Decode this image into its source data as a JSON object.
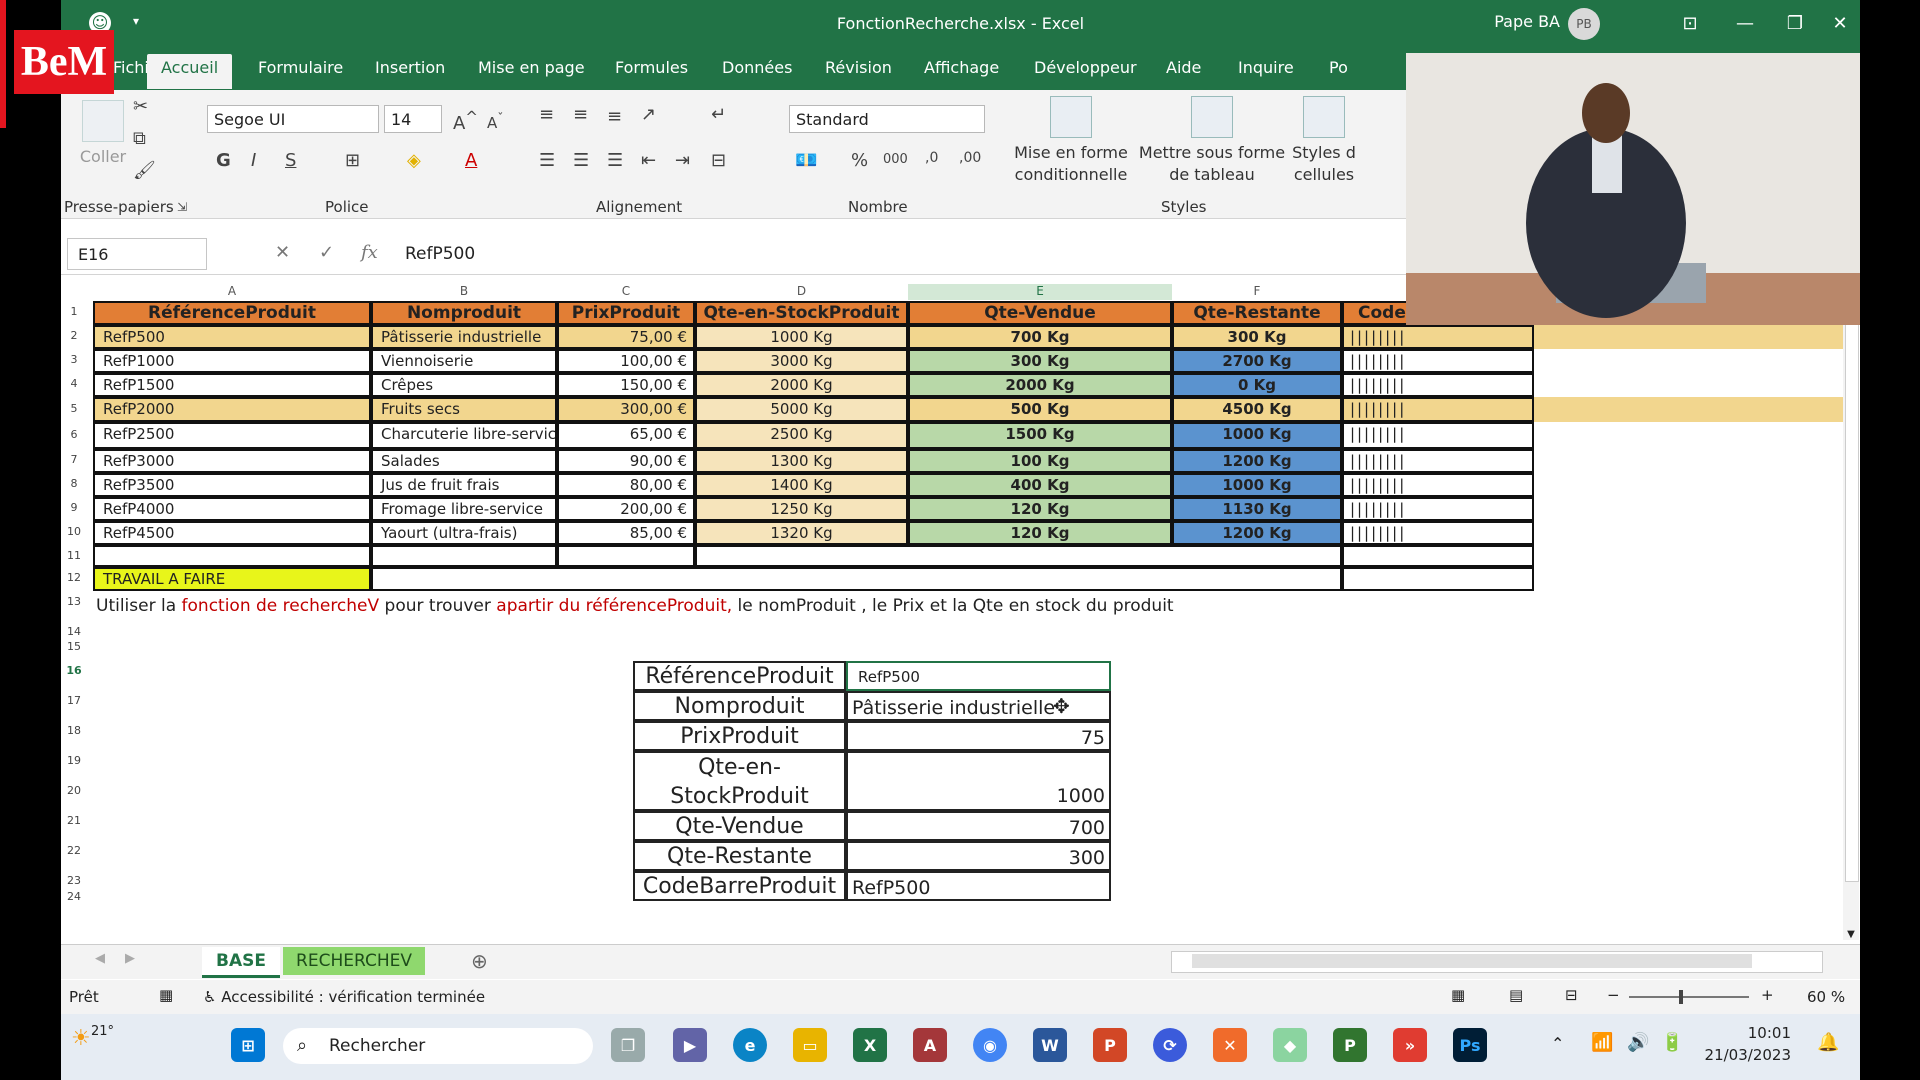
{
  "window": {
    "title": "FonctionRecherche.xlsx  -  Excel",
    "user": "Pape BA",
    "avatar": "PB"
  },
  "logo": {
    "text": "BeM"
  },
  "tabs": [
    "Fichier",
    "Accueil",
    "Formulaire",
    "Insertion",
    "Mise en page",
    "Formules",
    "Données",
    "Révision",
    "Affichage",
    "Développeur",
    "Aide",
    "Inquire",
    "Po"
  ],
  "active_tab": "Accueil",
  "ribbon": {
    "paste_label": "Coller",
    "group_clipboard": "Presse-papiers",
    "font_name": "Segoe UI",
    "font_size": "14",
    "group_font": "Police",
    "group_alignment": "Alignement",
    "number_format": "Standard",
    "group_number": "Nombre",
    "cond_format_1": "Mise en forme",
    "cond_format_2": "conditionnelle",
    "table_format_1": "Mettre sous forme",
    "table_format_2": "de tableau",
    "cell_styles_1": "Styles d",
    "cell_styles_2": "cellules",
    "group_styles": "Styles",
    "bold": "G",
    "italic": "I",
    "underline": "S",
    "percent": "%",
    "thousands": "000"
  },
  "formula_bar": {
    "name_box": "E16",
    "fx": "fx",
    "value": "RefP500"
  },
  "columns": [
    "A",
    "B",
    "C",
    "D",
    "E",
    "F"
  ],
  "table_headers": [
    "RéférenceProduit",
    "Nomproduit",
    "PrixProduit",
    "Qte-en-StockProduit",
    "Qte-Vendue",
    "Qte-Restante",
    "Code"
  ],
  "rows": [
    {
      "ref": "RefP500",
      "nom": "Pâtisserie industrielle",
      "prix": "75,00 €",
      "stock": "1000  Kg",
      "vendue": "700  Kg",
      "restante": "300  Kg",
      "code": "||||||||"
    },
    {
      "ref": "RefP1000",
      "nom": "Viennoiserie",
      "prix": "100,00 €",
      "stock": "3000  Kg",
      "vendue": "300  Kg",
      "restante": "2700  Kg",
      "code": "||||||||"
    },
    {
      "ref": "RefP1500",
      "nom": "Crêpes",
      "prix": "150,00 €",
      "stock": "2000  Kg",
      "vendue": "2000  Kg",
      "restante": "0  Kg",
      "code": "||||||||"
    },
    {
      "ref": "RefP2000",
      "nom": "Fruits secs",
      "prix": "300,00 €",
      "stock": "5000  Kg",
      "vendue": "500  Kg",
      "restante": "4500  Kg",
      "code": "||||||||"
    },
    {
      "ref": "RefP2500",
      "nom": "Charcuterie libre-service",
      "prix": "65,00 €",
      "stock": "2500  Kg",
      "vendue": "1500  Kg",
      "restante": "1000  Kg",
      "code": "||||||||"
    },
    {
      "ref": "RefP3000",
      "nom": "Salades",
      "prix": "90,00 €",
      "stock": "1300  Kg",
      "vendue": "100  Kg",
      "restante": "1200  Kg",
      "code": "||||||||"
    },
    {
      "ref": "RefP3500",
      "nom": "Jus de fruit frais",
      "prix": "80,00 €",
      "stock": "1400  Kg",
      "vendue": "400  Kg",
      "restante": "1000  Kg",
      "code": "||||||||"
    },
    {
      "ref": "RefP4000",
      "nom": "Fromage libre-service",
      "prix": "200,00 €",
      "stock": "1250  Kg",
      "vendue": "120  Kg",
      "restante": "1130  Kg",
      "code": "||||||||"
    },
    {
      "ref": "RefP4500",
      "nom": "Yaourt (ultra-frais)",
      "prix": "85,00 €",
      "stock": "1320  Kg",
      "vendue": "120  Kg",
      "restante": "1200  Kg",
      "code": "||||||||"
    }
  ],
  "row_numbers": [
    "1",
    "2",
    "3",
    "4",
    "5",
    "6",
    "7",
    "8",
    "9",
    "10",
    "11",
    "12",
    "13",
    "14",
    "15",
    "16",
    "17",
    "18",
    "19",
    "20",
    "21",
    "22",
    "23",
    "24"
  ],
  "travail": "TRAVAIL A FAIRE",
  "instruction": {
    "p1": "Utiliser la ",
    "p2": "fonction de rechercheV",
    "p3": " pour trouver ",
    "p4": "apartir du référenceProduit,",
    "p5": " le nomProduit , le Prix et la Qte en stock du produit"
  },
  "lookup": [
    {
      "label": "RéférenceProduit",
      "value": "RefP500"
    },
    {
      "label": "Nomproduit",
      "value": "Pâtisserie industrielle"
    },
    {
      "label": "PrixProduit",
      "value": "75"
    },
    {
      "label": "Qte-en-StockProduit",
      "value": "1000"
    },
    {
      "label": "Qte-Vendue",
      "value": "700"
    },
    {
      "label": "Qte-Restante",
      "value": "300"
    },
    {
      "label": "CodeBarreProduit",
      "value": "RefP500"
    }
  ],
  "sheets": [
    "BASE",
    "RECHERCHEV"
  ],
  "status": {
    "ready": "Prêt",
    "accessibility": "Accessibilité : vérification terminée",
    "zoom": "60 %"
  },
  "taskbar": {
    "weather": "21°",
    "search": "Rechercher",
    "time": "10:01",
    "date": "21/03/2023"
  },
  "colors": {
    "excel_green": "#217346",
    "header_orange": "#e27e35",
    "stock_beige": "#f6e4bb",
    "sold_green": "#b8d8a8",
    "remaining_blue": "#5b93cf",
    "highlight": "#f2d68e",
    "todo_yellow": "#e8f51a",
    "instruction_red": "#c00000"
  }
}
